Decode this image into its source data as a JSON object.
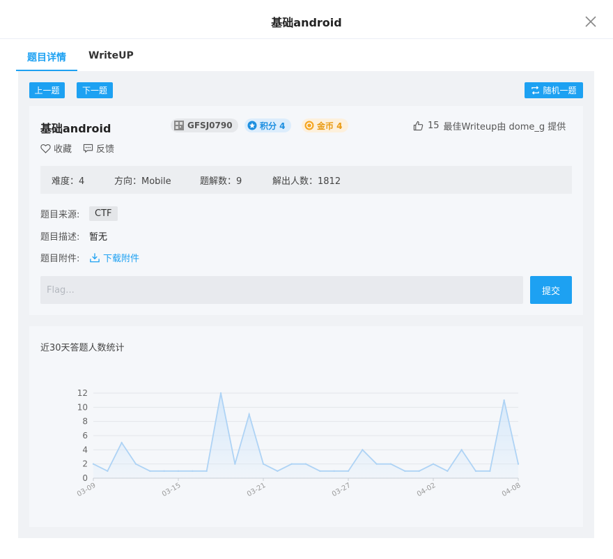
{
  "modal": {
    "title": "基础android"
  },
  "tabs": [
    {
      "label": "题目详情"
    },
    {
      "label": "WriteUP"
    }
  ],
  "toolbar": {
    "prev_label": "上一题",
    "next_label": "下一题",
    "random_label": "随机一题"
  },
  "challenge": {
    "title": "基础android",
    "id": "GFSJ0790",
    "score_label": "积分 4",
    "coin_label": "金币 4",
    "likes": "15",
    "best_writeup": "最佳Writeup由 dome_g 提供",
    "favorite_label": "收藏",
    "feedback_label": "反馈",
    "stats": {
      "difficulty": "难度：4",
      "direction": "方向：Mobile",
      "solves_count": "题解数：9",
      "solvers": "解出人数：1812"
    },
    "source_label": "题目来源:",
    "source_value": "CTF",
    "description_label": "题目描述:",
    "description_value": "暂无",
    "attachment_label": "题目附件:",
    "download_label": "下载附件",
    "flag_placeholder": "Flag...",
    "submit_label": "提交"
  },
  "chart_title": "近30天答题人数统计",
  "chart_data": {
    "type": "area",
    "title": "近30天答题人数统计",
    "x": [
      "03-09",
      "03-10",
      "03-11",
      "03-12",
      "03-13",
      "03-14",
      "03-15",
      "03-16",
      "03-17",
      "03-18",
      "03-19",
      "03-20",
      "03-21",
      "03-22",
      "03-23",
      "03-24",
      "03-25",
      "03-26",
      "03-27",
      "03-28",
      "03-29",
      "03-30",
      "03-31",
      "04-01",
      "04-02",
      "04-03",
      "04-04",
      "04-05",
      "04-06",
      "04-07",
      "04-08"
    ],
    "values": [
      2,
      1,
      5,
      2,
      1,
      1,
      1,
      1,
      1,
      12,
      2,
      9,
      2,
      1,
      2,
      2,
      1,
      1,
      1,
      4,
      2,
      2,
      1,
      1,
      2,
      1,
      4,
      1,
      1,
      11,
      2
    ],
    "xtick_labels": [
      "03-09",
      "03-15",
      "03-21",
      "03-27",
      "04-02",
      "04-08"
    ],
    "yticks": [
      0,
      2,
      4,
      6,
      8,
      10,
      12
    ],
    "ylim": [
      0,
      12
    ],
    "grid": true,
    "colors": {
      "line": "#aed3f5",
      "fill": "#d3e7fa"
    }
  }
}
